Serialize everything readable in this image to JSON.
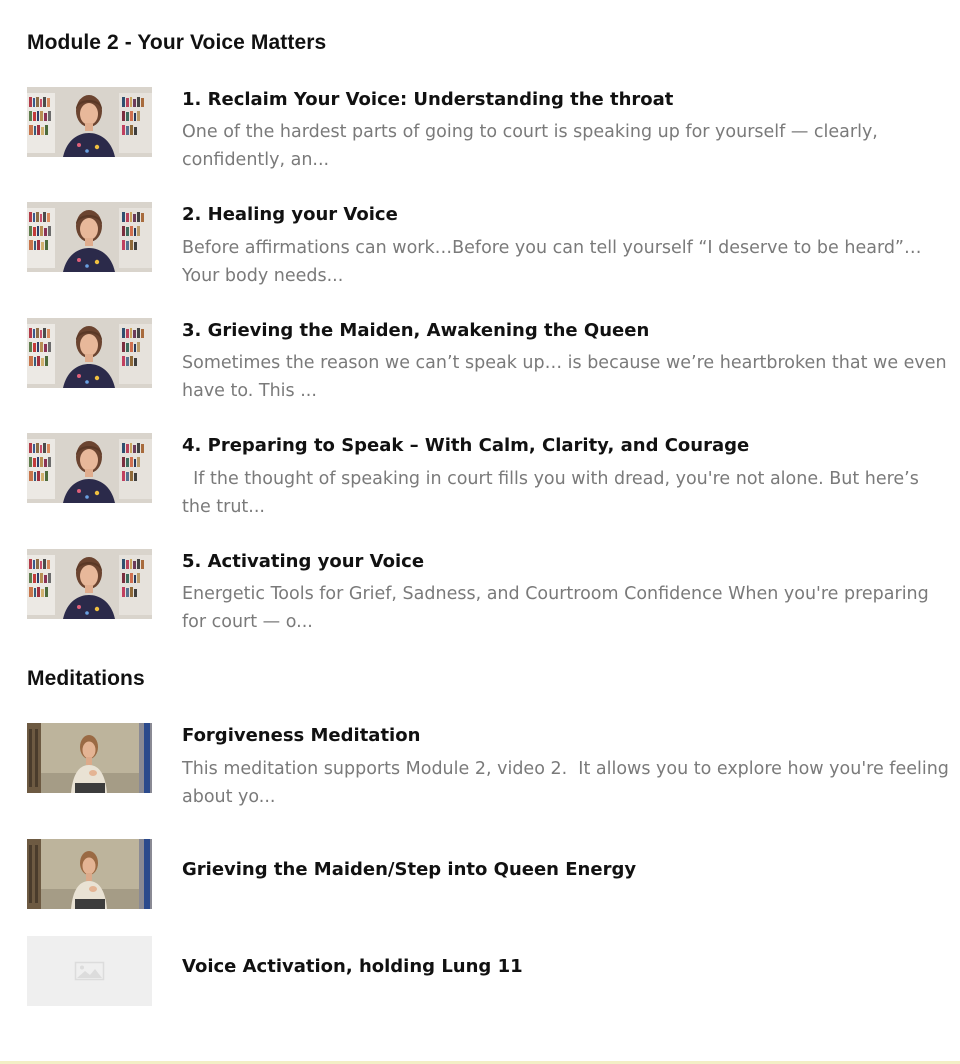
{
  "module": {
    "title": "Module 2 - Your Voice Matters",
    "lessons": [
      {
        "title": "1. Reclaim Your Voice: Understanding the throat",
        "description": "One of the hardest parts of going to court is speaking up for yourself — clearly, confidently, an...",
        "thumbnail": "video-thumbnail-presenter-bookshelf"
      },
      {
        "title": "2. Healing your Voice",
        "description": "Before affirmations can work…Before you can tell yourself “I deserve to be heard”…Your body needs...",
        "thumbnail": "video-thumbnail-presenter-bookshelf"
      },
      {
        "title": "3. Grieving the Maiden, Awakening the Queen",
        "description": "Sometimes the reason we can’t speak up… is because we’re heartbroken that we even have to. This ...",
        "thumbnail": "video-thumbnail-presenter-bookshelf"
      },
      {
        "title": "4. Preparing to Speak – With Calm, Clarity, and Courage",
        "description": "  If the thought of speaking in court fills you with dread, you're not alone. But here’s the trut...",
        "thumbnail": "video-thumbnail-presenter-bookshelf"
      },
      {
        "title": "5. Activating your Voice",
        "description": "Energetic Tools for Grief, Sadness, and Courtroom Confidence When you're preparing for court — o...",
        "thumbnail": "video-thumbnail-presenter-bookshelf"
      }
    ]
  },
  "meditations": {
    "title": "Meditations",
    "lessons": [
      {
        "title": "Forgiveness Meditation",
        "description": "This meditation supports Module 2, video 2.  It allows you to explore how you're feeling about yo...",
        "thumbnail": "video-thumbnail-presenter-seated"
      },
      {
        "title": "Grieving the Maiden/Step into Queen Energy",
        "description": "",
        "thumbnail": "video-thumbnail-presenter-seated"
      },
      {
        "title": "Voice Activation, holding Lung 11",
        "description": "",
        "thumbnail": "image-placeholder-icon"
      }
    ]
  },
  "colors": {
    "heading": "#111111",
    "description": "#7a7a7a",
    "placeholder_bg": "#efefef",
    "bottom_rule": "#f3efc6"
  }
}
